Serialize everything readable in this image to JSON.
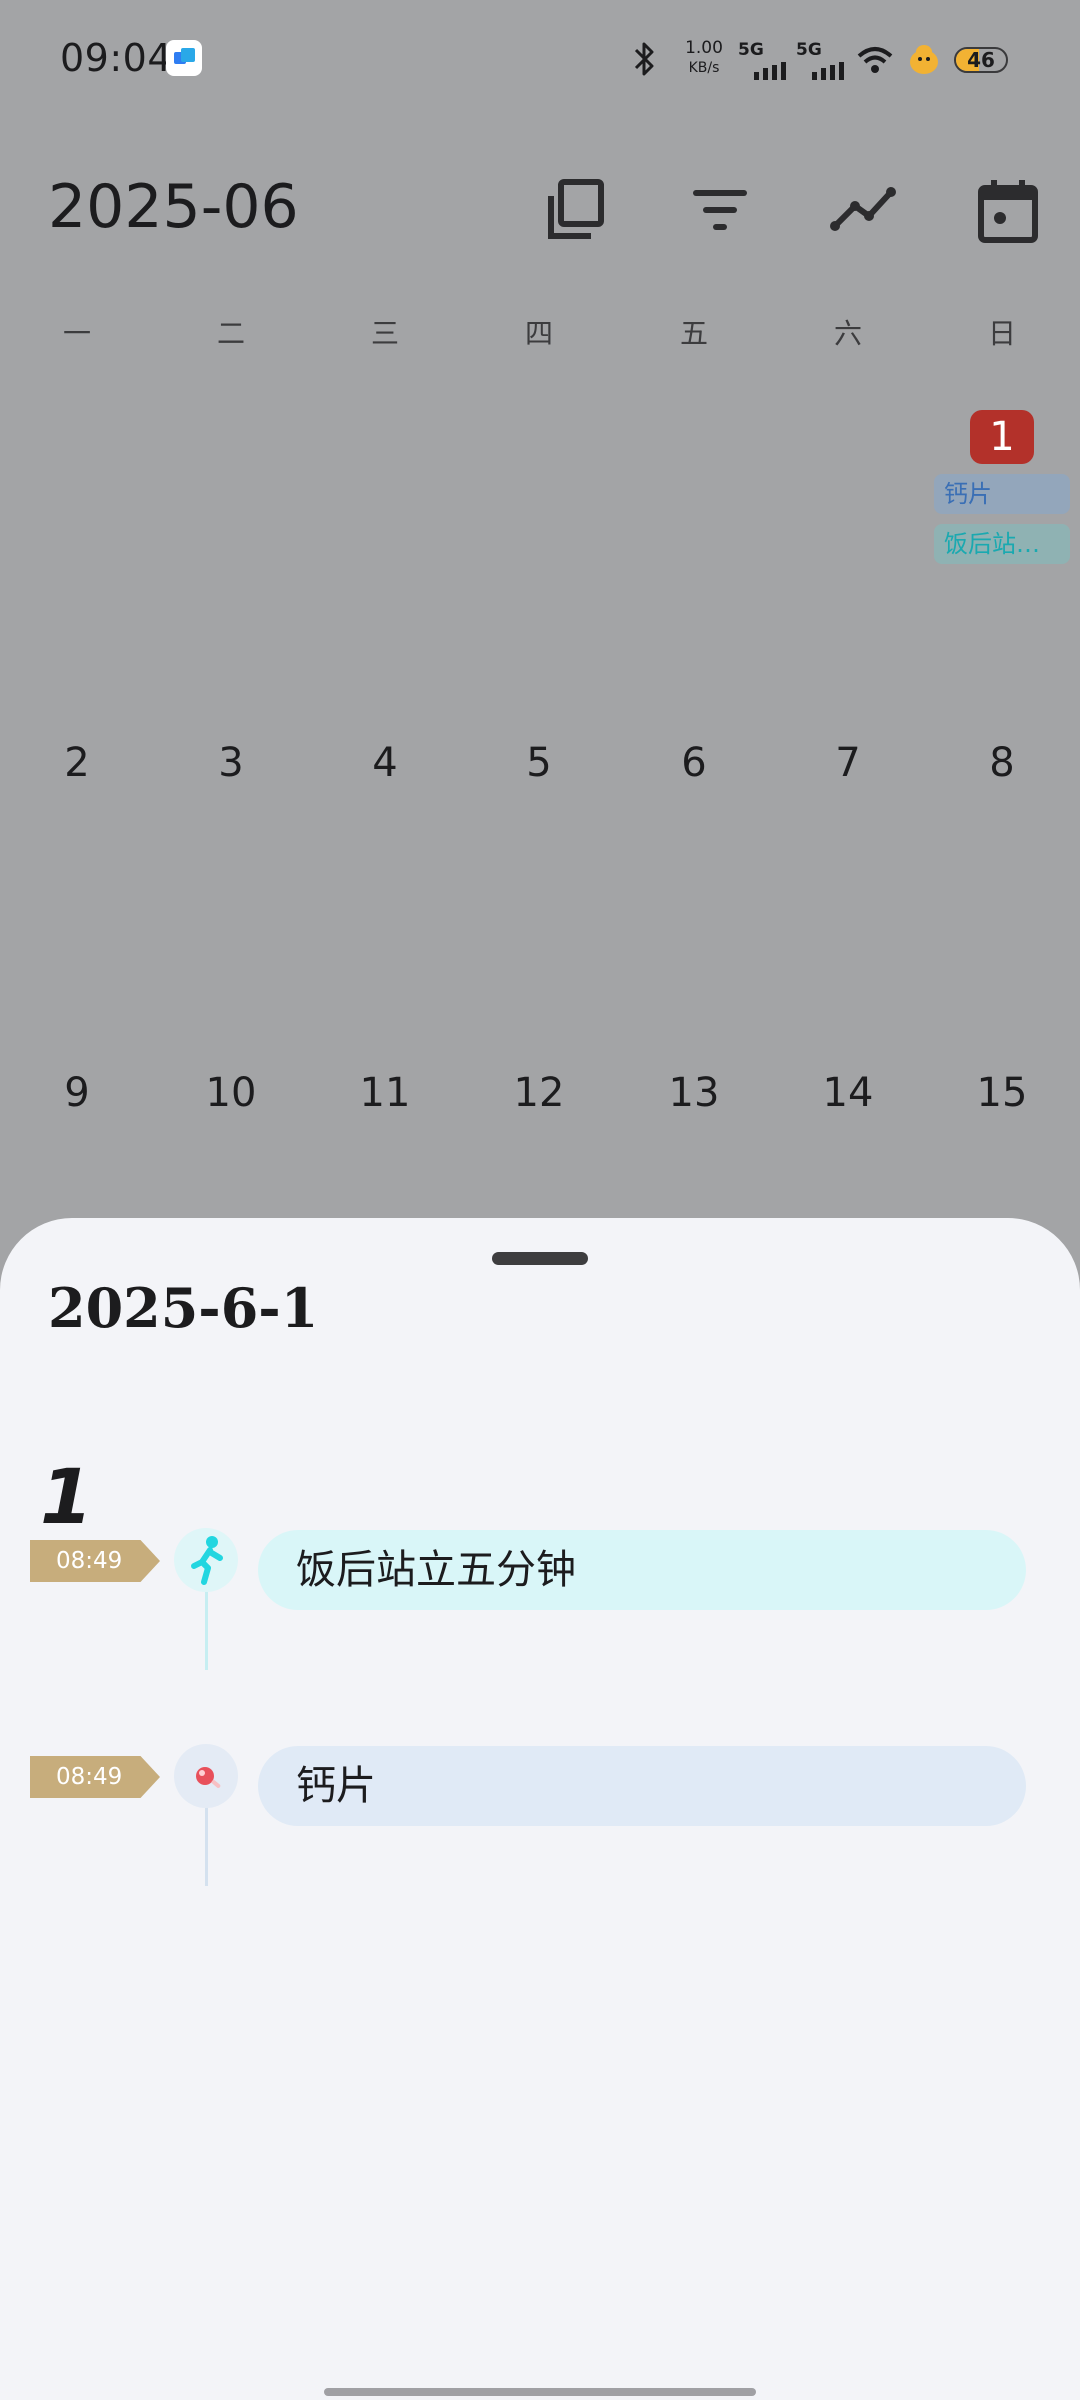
{
  "status_bar": {
    "time": "09:04",
    "net_speed_value": "1.00",
    "net_speed_unit": "KB/s",
    "sim1": "5G",
    "sim2": "5G",
    "battery_level": "46",
    "battery_fraction": 0.46,
    "icons": [
      "app-notification-icon",
      "bluetooth-icon",
      "signal-icon",
      "wifi-icon",
      "pet-icon",
      "battery-icon"
    ]
  },
  "header": {
    "month": "2025-06",
    "icons": [
      "copy-icon",
      "filter-icon",
      "trend-chart-icon",
      "calendar-today-icon"
    ]
  },
  "calendar": {
    "weekdays": [
      "一",
      "二",
      "三",
      "四",
      "五",
      "六",
      "日"
    ],
    "selected_day": "1",
    "week2": [
      "2",
      "3",
      "4",
      "5",
      "6",
      "7",
      "8"
    ],
    "week3": [
      "9",
      "10",
      "11",
      "12",
      "13",
      "14",
      "15"
    ],
    "day1_tags": [
      "钙片",
      "饭后站…"
    ],
    "colors": {
      "badge": "#b3312a",
      "tag_blue": "#3a6fb5",
      "tag_teal": "#1aa9b0"
    }
  },
  "sheet": {
    "date": "2025-6-1",
    "group_label": "1",
    "events": [
      {
        "time": "08:49",
        "title": "饭后站立五分钟",
        "icon": "standing-person-icon",
        "color": "#d9f6f8"
      },
      {
        "time": "08:49",
        "title": "钙片",
        "icon": "pill-icon",
        "color": "#e0eaf6"
      }
    ]
  }
}
